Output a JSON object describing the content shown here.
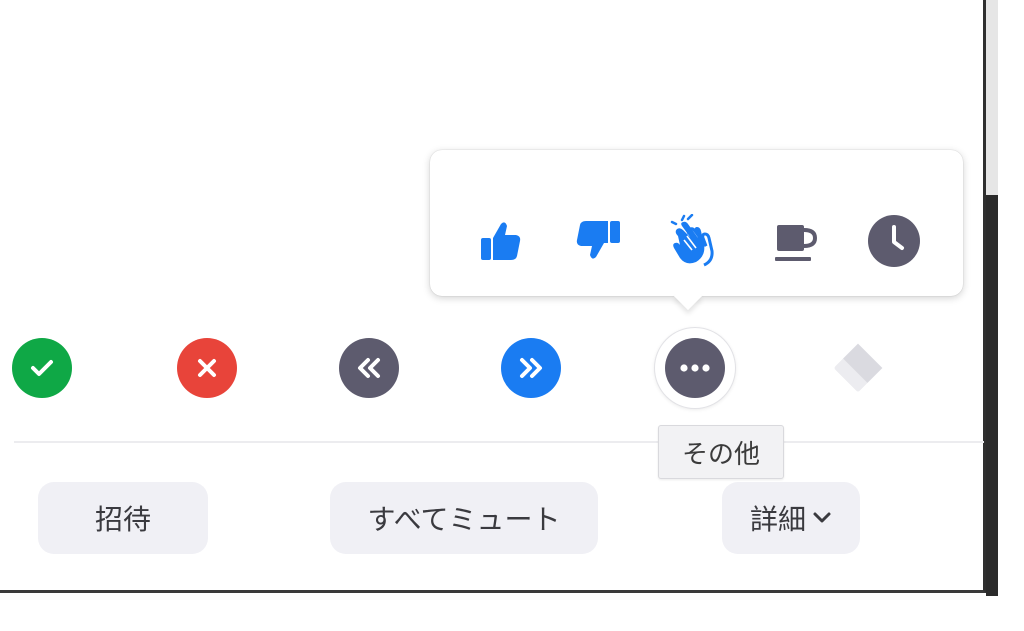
{
  "reactions": {
    "thumbs_up": "thumbs-up-icon",
    "thumbs_down": "thumbs-down-icon",
    "clap": "clapping-hands-icon",
    "coffee": "coffee-cup-icon",
    "away": "clock-icon"
  },
  "actions": {
    "yes": "check-icon",
    "no": "x-icon",
    "slower": "double-chevron-left-icon",
    "faster": "double-chevron-right-icon",
    "more": "more-dots-icon",
    "clear": "eraser-icon"
  },
  "tooltip": {
    "more_label": "その他"
  },
  "footer": {
    "invite_label": "招待",
    "mute_all_label": "すべてミュート",
    "more_label": "詳細"
  },
  "colors": {
    "blue": "#1a7cf2",
    "green": "#0fa846",
    "red": "#e8443a",
    "gray": "#5d5b6e"
  }
}
